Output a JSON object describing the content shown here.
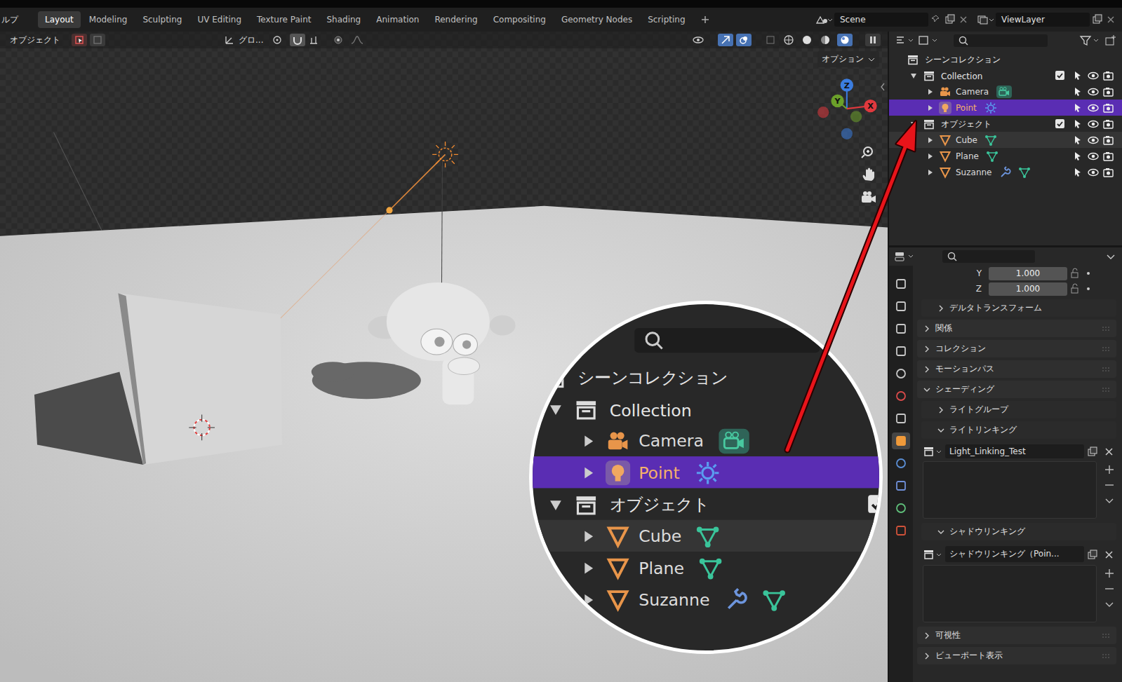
{
  "topbar": {
    "menu_cut": "ルプ",
    "tabs": [
      {
        "label": "Layout",
        "selected": true
      },
      {
        "label": "Modeling",
        "selected": false
      },
      {
        "label": "Sculpting",
        "selected": false
      },
      {
        "label": "UV Editing",
        "selected": false
      },
      {
        "label": "Texture Paint",
        "selected": false
      },
      {
        "label": "Shading",
        "selected": false
      },
      {
        "label": "Animation",
        "selected": false
      },
      {
        "label": "Rendering",
        "selected": false
      },
      {
        "label": "Compositing",
        "selected": false
      },
      {
        "label": "Geometry Nodes",
        "selected": false
      },
      {
        "label": "Scripting",
        "selected": false
      }
    ],
    "scene": "Scene",
    "view_layer": "ViewLayer"
  },
  "viewport": {
    "mode": "オブジェクト",
    "orientation": "グロ...",
    "options": "オプション",
    "gizmo": [
      {
        "label": "Z",
        "color": "#3b7de0"
      },
      {
        "label": "Y",
        "color": "#6ba02a"
      },
      {
        "label": "X",
        "color": "#e0393e"
      }
    ]
  },
  "outliner": {
    "items": [
      {
        "label": "シーンコレクション",
        "kind": "scene",
        "depth": 0,
        "expanded": true,
        "checked": true,
        "selected": false,
        "highlighted": false,
        "modifier": false
      },
      {
        "label": "Collection",
        "kind": "collection",
        "depth": 0,
        "expanded": true,
        "checked": true,
        "selected": false,
        "highlighted": false,
        "modifier": false
      },
      {
        "label": "Camera",
        "kind": "camera",
        "depth": 1,
        "expanded": false,
        "checked": false,
        "selected": false,
        "highlighted": false,
        "modifier": false
      },
      {
        "label": "Point",
        "kind": "light",
        "depth": 1,
        "expanded": false,
        "checked": false,
        "selected": true,
        "highlighted": false,
        "modifier": false
      },
      {
        "label": "オブジェクト",
        "kind": "collection",
        "depth": 0,
        "expanded": true,
        "checked": true,
        "selected": false,
        "highlighted": false,
        "modifier": false
      },
      {
        "label": "Cube",
        "kind": "mesh",
        "depth": 1,
        "expanded": false,
        "checked": false,
        "selected": false,
        "highlighted": true,
        "modifier": false
      },
      {
        "label": "Plane",
        "kind": "mesh",
        "depth": 1,
        "expanded": false,
        "checked": false,
        "selected": false,
        "highlighted": false,
        "modifier": false
      },
      {
        "label": "Suzanne",
        "kind": "mesh",
        "depth": 1,
        "expanded": false,
        "checked": false,
        "selected": false,
        "highlighted": false,
        "modifier": true
      }
    ]
  },
  "properties": {
    "tabs": [
      {
        "kind": "tool",
        "selected": false
      },
      {
        "kind": "render",
        "selected": false
      },
      {
        "kind": "output",
        "selected": false
      },
      {
        "kind": "view_layer",
        "selected": false
      },
      {
        "kind": "scene",
        "selected": false
      },
      {
        "kind": "world",
        "selected": false
      },
      {
        "kind": "collection",
        "selected": false
      },
      {
        "kind": "object",
        "selected": true
      },
      {
        "kind": "physics",
        "selected": false
      },
      {
        "kind": "constraints",
        "selected": false
      },
      {
        "kind": "data",
        "selected": false
      },
      {
        "kind": "texture",
        "selected": false
      }
    ],
    "rows": [
      {
        "kind": "field",
        "label": "Y",
        "value": "1.000"
      },
      {
        "kind": "field",
        "label": "Z",
        "value": "1.000"
      },
      {
        "kind": "panel",
        "label": "デルタトランスフォーム",
        "depth": 1,
        "expanded": false
      },
      {
        "kind": "panel",
        "label": "関係",
        "depth": 0,
        "expanded": false
      },
      {
        "kind": "panel",
        "label": "コレクション",
        "depth": 0,
        "expanded": false
      },
      {
        "kind": "panel",
        "label": "モーションパス",
        "depth": 0,
        "expanded": false
      },
      {
        "kind": "panel",
        "label": "シェーディング",
        "depth": 0,
        "expanded": true
      },
      {
        "kind": "panel",
        "label": "ライトグループ",
        "depth": 1,
        "expanded": false
      },
      {
        "kind": "panel",
        "label": "ライトリンキング",
        "depth": 1,
        "expanded": true
      },
      {
        "kind": "collection",
        "value": "Light_Linking_Test"
      },
      {
        "kind": "panel",
        "label": "シャドウリンキング",
        "depth": 1,
        "expanded": true
      },
      {
        "kind": "collection",
        "value": "シャドウリンキング（Poin..."
      },
      {
        "kind": "panel",
        "label": "可視性",
        "depth": 0,
        "expanded": false
      },
      {
        "kind": "panel",
        "label": "ビューポート表示",
        "depth": 0,
        "expanded": false
      }
    ]
  }
}
